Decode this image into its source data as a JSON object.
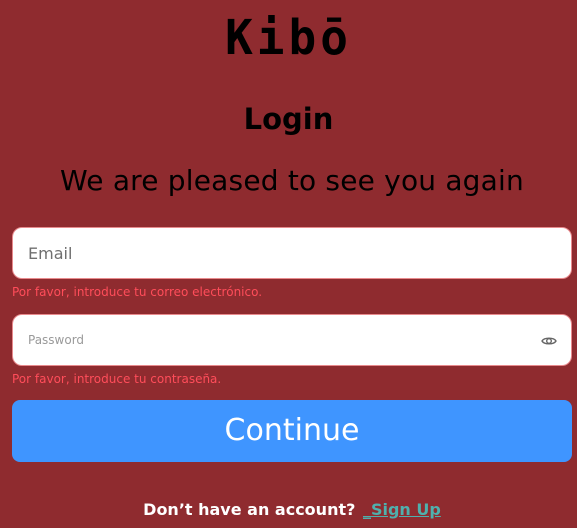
{
  "brand": {
    "logo_text": "Kibō"
  },
  "login": {
    "title": "Login",
    "subtitle": "We are pleased to see you again",
    "email": {
      "placeholder": "Email",
      "value": "",
      "error": "Por favor, introduce tu correo electrónico."
    },
    "password": {
      "placeholder": "Password",
      "value": "",
      "error": "Por favor, introduce tu contraseña.",
      "toggle_icon": "eye-icon"
    },
    "continue_label": "Continue",
    "signup_prompt": "Don’t have an account?",
    "signup_link": "_Sign Up"
  },
  "colors": {
    "background": "#8f2b2f",
    "button": "#3f95ff",
    "error": "#ff4d5a",
    "link": "#4fb0ad",
    "field_border": "#e88a8d"
  }
}
